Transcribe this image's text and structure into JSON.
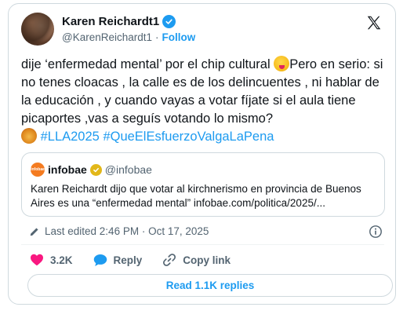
{
  "author": {
    "display_name": "Karen Reichardt1",
    "handle": "@KarenReichardt1",
    "separator": "·",
    "follow_label": "Follow"
  },
  "tweet": {
    "text_part1": "dije ‘enfermedad mental’ por el chip cultural ",
    "text_part2": "Pero en serio: si  no tenes cloacas  , la calle es de los delincuentes , ni hablar de la educación , y cuando vayas a votar fíjate si el aula tiene picaportes ,vas a seguís votando lo mismo? ",
    "hashtag1": "#LLA2025",
    "hashtag2": "#QueElEsfuerzoValgaLaPena",
    "emoji1": "zany-face-emoji",
    "emoji2": "lion-emoji"
  },
  "quote": {
    "avatar_text": "infobae",
    "name": "infobae",
    "handle": "@infobae",
    "text": "Karen Reichardt dijo que votar al kirchnerismo en provincia de Buenos Aires es una “enfermedad mental” infobae.com/politica/2025/..."
  },
  "meta": {
    "edited_text": "Last edited 2:46 PM · Oct 17, 2025"
  },
  "actions": {
    "like_count": "3.2K",
    "reply_label": "Reply",
    "copy_link_label": "Copy link"
  },
  "replies_button": "Read 1.1K replies",
  "colors": {
    "accent": "#1d9bf0",
    "like": "#f91880",
    "muted": "#536471",
    "border": "#cfd9de"
  }
}
